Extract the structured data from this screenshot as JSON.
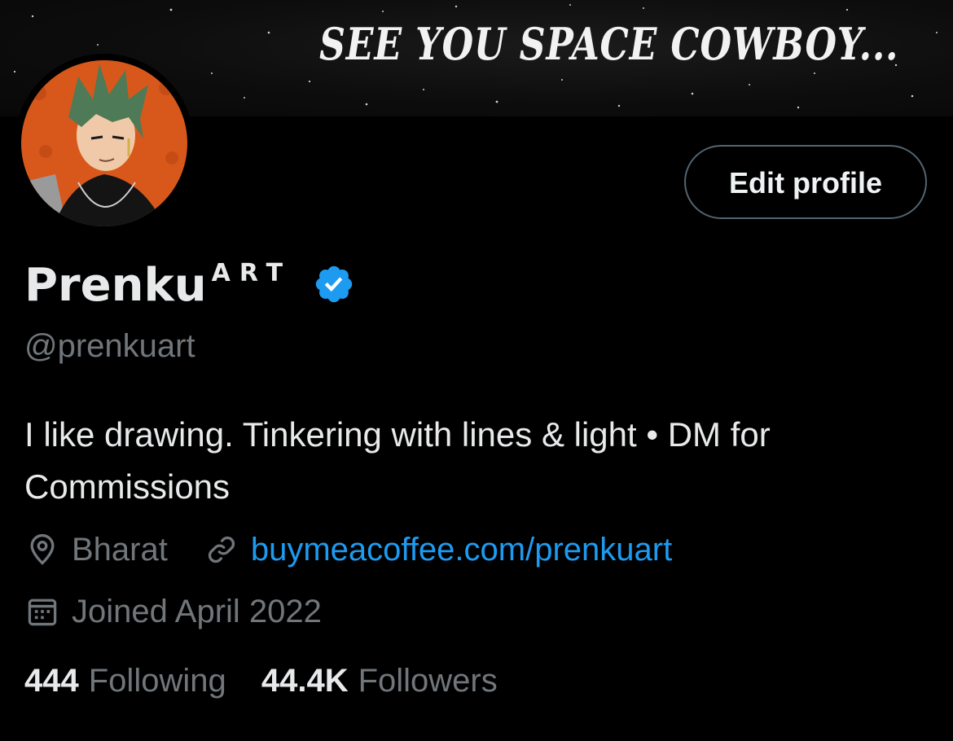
{
  "banner": {
    "text": "SEE YOU SPACE COWBOY..."
  },
  "profile": {
    "edit_label": "Edit profile",
    "display_name": "Prenku",
    "name_suffix": "ART",
    "handle": "@prenkuart",
    "bio": "I like drawing. Tinkering with lines & light • DM for Commissions",
    "location": "Bharat",
    "website": "buymeacoffee.com/prenkuart",
    "joined": "Joined April 2022"
  },
  "stats": {
    "following_count": "444",
    "following_label": "Following",
    "followers_count": "44.4K",
    "followers_label": "Followers"
  },
  "icons": {
    "verified": "verified-badge-icon",
    "location": "location-pin-icon",
    "link": "link-icon",
    "calendar": "calendar-icon"
  },
  "colors": {
    "background": "#000000",
    "text_primary": "#e7e9ea",
    "text_secondary": "#71767b",
    "link": "#1d9bf0",
    "verified": "#1d9bf0",
    "avatar_bg": "#d8581c"
  }
}
